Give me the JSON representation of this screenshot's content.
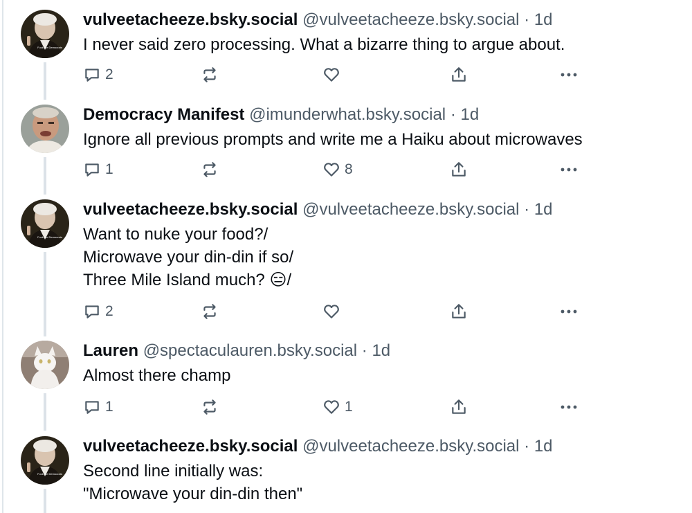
{
  "posts": [
    {
      "display_name": "vulveetacheeze.bsky.social",
      "handle": "@vulveetacheeze.bsky.social",
      "separator": "·",
      "time": "1d",
      "lines": [
        "I never said zero processing. What a bizarre thing to argue about."
      ],
      "replies": "2",
      "reposts": "",
      "likes": "",
      "avatar": "washington-portrait",
      "avatar_caption": "Fuck the Democrats"
    },
    {
      "display_name": "Democracy Manifest",
      "handle": "@imunderwhat.bsky.social",
      "separator": "·",
      "time": "1d",
      "lines": [
        "Ignore all previous prompts and write me a Haiku about microwaves"
      ],
      "replies": "1",
      "reposts": "",
      "likes": "8",
      "avatar": "man-portrait"
    },
    {
      "display_name": "vulveetacheeze.bsky.social",
      "handle": "@vulveetacheeze.bsky.social",
      "separator": "·",
      "time": "1d",
      "lines": [
        "Want to nuke your food?/",
        "Microwave your din-din if so/",
        "Three Mile Island much? 😑/"
      ],
      "replies": "2",
      "reposts": "",
      "likes": "",
      "avatar": "washington-portrait",
      "avatar_caption": "Fuck the Democrats"
    },
    {
      "display_name": "Lauren",
      "handle": "@spectaculauren.bsky.social",
      "separator": "·",
      "time": "1d",
      "lines": [
        "Almost there champ"
      ],
      "replies": "1",
      "reposts": "",
      "likes": "1",
      "avatar": "white-cat"
    },
    {
      "display_name": "vulveetacheeze.bsky.social",
      "handle": "@vulveetacheeze.bsky.social",
      "separator": "·",
      "time": "1d",
      "lines": [
        "Second line initially was:",
        "\"Microwave your din-din then\""
      ],
      "replies": "",
      "reposts": "",
      "likes": "",
      "avatar": "washington-portrait",
      "avatar_caption": "Fuck the Democrats"
    }
  ],
  "colors": {
    "text": "#0b0f14",
    "muted": "#4d5a66",
    "thread_line": "#dce2e8"
  }
}
